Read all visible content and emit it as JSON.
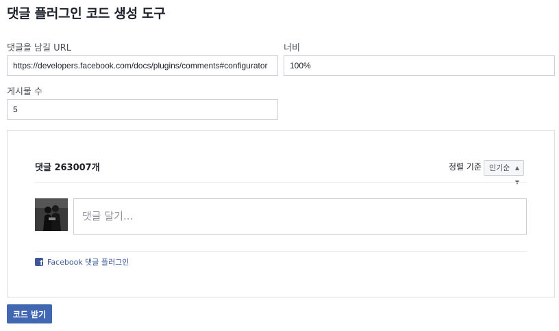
{
  "page": {
    "title": "댓글 플러그인 코드 생성 도구"
  },
  "form": {
    "url_label": "댓글을 남길 URL",
    "url_value": "https://developers.facebook.com/docs/plugins/comments#configurator",
    "width_label": "너비",
    "width_value": "100%",
    "posts_label": "게시물 수",
    "posts_value": "5"
  },
  "preview": {
    "comment_count": "댓글 263007개",
    "sort_label": "정렬 기준",
    "sort_value": "인기순",
    "sort_arrow_icon": "sort-arrows-icon",
    "comment_placeholder": "댓글 달기...",
    "footer_link": "Facebook 댓글 플러그인",
    "footer_icon": "facebook-logo-icon"
  },
  "actions": {
    "get_code": "코드 받기"
  },
  "colors": {
    "button": "#4267b2",
    "link": "#385898",
    "border": "#ccd0d5"
  }
}
